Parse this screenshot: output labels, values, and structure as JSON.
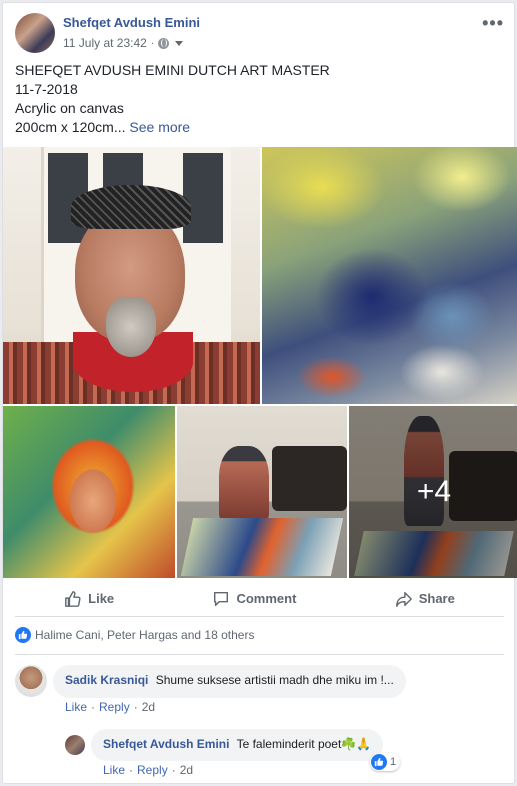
{
  "post": {
    "author": "Shefqet Avdush Emini",
    "timestamp": "11 July at 23:42",
    "privacy_separator": "·",
    "text_lines": [
      "SHEFQET AVDUSH EMINI DUTCH ART MASTER",
      "11-7-2018",
      "Acrylic on canvas",
      "200cm x 120cm..."
    ],
    "see_more": "See more",
    "more_photos_count": "+4",
    "icons": {
      "privacy": "globe-icon",
      "audience": "chevron-down-icon",
      "options": "more-options-icon"
    }
  },
  "actions": {
    "like": "Like",
    "comment": "Comment",
    "share": "Share"
  },
  "reactions": {
    "summary": "Halime Cani, Peter Hargas and 18 others",
    "icon": "like-icon",
    "color": "#2078f4"
  },
  "comments": [
    {
      "author": "Sadik Krasniqi",
      "text": "Shume suksese artistii madh dhe miku im !...",
      "like": "Like",
      "reply": "Reply",
      "time": "2d",
      "separator": "·"
    },
    {
      "author": "Shefqet Avdush Emini",
      "text": "Te faleminderit poet☘️🙏",
      "like": "Like",
      "reply": "Reply",
      "time": "2d",
      "separator": "·",
      "reaction_count": "1"
    }
  ],
  "colors": {
    "link": "#385898",
    "muted": "#616770",
    "bubble": "#f2f3f5",
    "accent": "#4267b2"
  }
}
